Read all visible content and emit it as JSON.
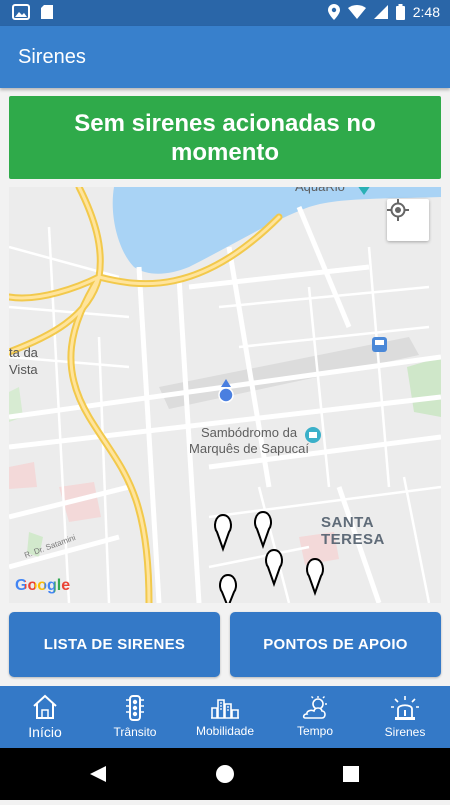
{
  "status_bar": {
    "time": "2:48"
  },
  "app_bar": {
    "title": "Sirenes"
  },
  "banner": {
    "text": "Sem sirenes acionadas no momento"
  },
  "map": {
    "labels": {
      "aquario": "AquaRio",
      "vista_1": "ta da",
      "vista_2": "Vista",
      "sambodromo": "Sambódromo da Marquês de Sapucaí",
      "santa_teresa": "SANTA TERESA",
      "street": "R. Dr. Satamini"
    },
    "google_logo": "Google"
  },
  "buttons": {
    "lista": "LISTA DE SIRENES",
    "pontos": "PONTOS DE APOIO"
  },
  "bottom_nav": {
    "items": [
      {
        "label": "Início",
        "icon": "home-icon"
      },
      {
        "label": "Trânsito",
        "icon": "traffic-light-icon"
      },
      {
        "label": "Mobilidade",
        "icon": "city-icon"
      },
      {
        "label": "Tempo",
        "icon": "weather-icon"
      },
      {
        "label": "Sirenes",
        "icon": "siren-icon"
      }
    ]
  },
  "colors": {
    "app_bar": "#3880cc",
    "banner": "#2faa4a",
    "buttons": "#3479c7",
    "water": "#a9d3f5",
    "road_major": "#f7d774"
  }
}
